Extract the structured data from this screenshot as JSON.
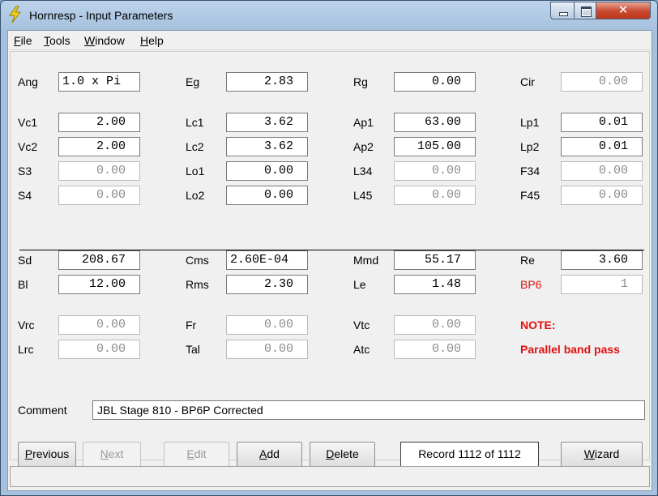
{
  "window": {
    "title": "Hornresp - Input Parameters",
    "close_glyph": "✕"
  },
  "menu": {
    "file": {
      "key": "F",
      "rest": "ile"
    },
    "tools": {
      "key": "T",
      "rest": "ools"
    },
    "window": {
      "key": "W",
      "rest": "indow"
    },
    "help": {
      "key": "H",
      "rest": "elp"
    }
  },
  "params": {
    "ang": {
      "label": "Ang",
      "value": "1.0 x Pi"
    },
    "eg": {
      "label": "Eg",
      "value": "2.83"
    },
    "rg": {
      "label": "Rg",
      "value": "0.00"
    },
    "cir": {
      "label": "Cir",
      "value": "0.00"
    },
    "vc1": {
      "label": "Vc1",
      "value": "2.00"
    },
    "lc1": {
      "label": "Lc1",
      "value": "3.62"
    },
    "ap1": {
      "label": "Ap1",
      "value": "63.00"
    },
    "lp1": {
      "label": "Lp1",
      "value": "0.01"
    },
    "vc2": {
      "label": "Vc2",
      "value": "2.00"
    },
    "lc2": {
      "label": "Lc2",
      "value": "3.62"
    },
    "ap2": {
      "label": "Ap2",
      "value": "105.00"
    },
    "lp2": {
      "label": "Lp2",
      "value": "0.01"
    },
    "s3": {
      "label": "S3",
      "value": "0.00"
    },
    "lo1": {
      "label": "Lo1",
      "value": "0.00"
    },
    "l34": {
      "label": "L34",
      "value": "0.00"
    },
    "f34": {
      "label": "F34",
      "value": "0.00"
    },
    "s4": {
      "label": "S4",
      "value": "0.00"
    },
    "lo2": {
      "label": "Lo2",
      "value": "0.00"
    },
    "l45": {
      "label": "L45",
      "value": "0.00"
    },
    "f45": {
      "label": "F45",
      "value": "0.00"
    },
    "sd": {
      "label": "Sd",
      "value": "208.67"
    },
    "cms": {
      "label": "Cms",
      "value": "2.60E-04"
    },
    "mmd": {
      "label": "Mmd",
      "value": "55.17"
    },
    "re": {
      "label": "Re",
      "value": "3.60"
    },
    "bl": {
      "label": "Bl",
      "value": "12.00"
    },
    "rms": {
      "label": "Rms",
      "value": "2.30"
    },
    "le": {
      "label": "Le",
      "value": "1.48"
    },
    "bp6": {
      "label": "BP6",
      "value": "1"
    },
    "vrc": {
      "label": "Vrc",
      "value": "0.00"
    },
    "fr": {
      "label": "Fr",
      "value": "0.00"
    },
    "vtc": {
      "label": "Vtc",
      "value": "0.00"
    },
    "lrc": {
      "label": "Lrc",
      "value": "0.00"
    },
    "tal": {
      "label": "Tal",
      "value": "0.00"
    },
    "atc": {
      "label": "Atc",
      "value": "0.00"
    }
  },
  "note": {
    "title": "NOTE:",
    "text": "Parallel band pass"
  },
  "comment": {
    "label": "Comment",
    "value": "JBL Stage 810 - BP6P Corrected"
  },
  "buttons": {
    "previous": {
      "key": "P",
      "rest": "revious"
    },
    "next": {
      "key": "N",
      "rest": "ext"
    },
    "edit": {
      "key": "E",
      "rest": "dit"
    },
    "add": {
      "key": "A",
      "rest": "dd"
    },
    "delete": {
      "key": "D",
      "rest": "elete"
    },
    "wizard": {
      "key": "W",
      "rest": "izard"
    }
  },
  "record": "Record 1112 of 1112",
  "colors": {
    "accent_red": "#e01010",
    "title_bar": "#bcd3ea"
  }
}
